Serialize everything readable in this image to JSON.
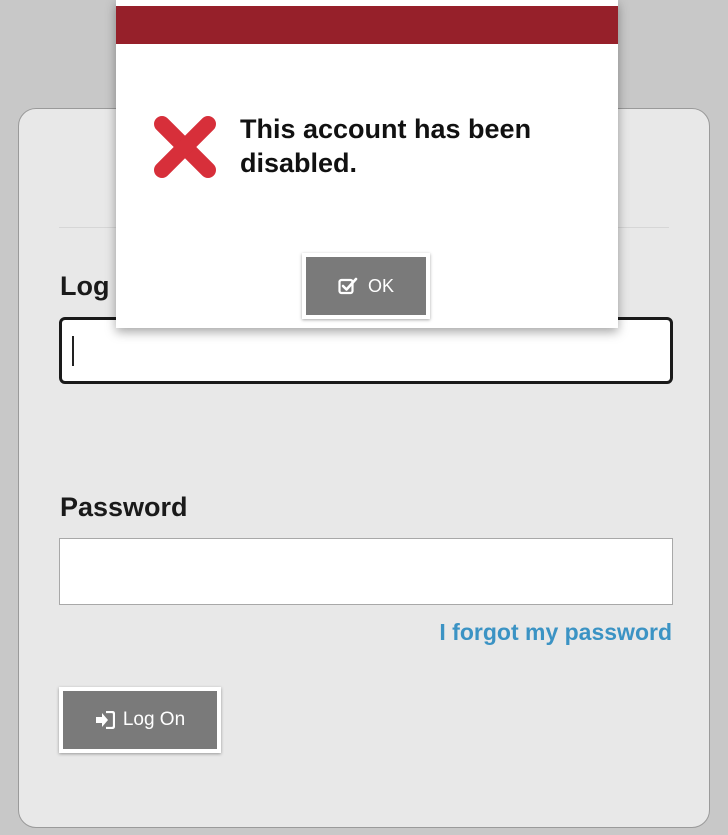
{
  "login_form": {
    "login_label": "Log",
    "login_value": "",
    "password_label": "Password",
    "password_value": "",
    "forgot_password_link": "I forgot my password",
    "logon_button_label": "Log On",
    "logon_icon": "sign-in-icon"
  },
  "dialog": {
    "message": "This account has been disabled.",
    "icon": "error-x-icon",
    "ok_button_label": "OK",
    "ok_icon": "check-square-icon"
  },
  "colors": {
    "page_background": "#c8c8c8",
    "panel_background": "#e8e8e8",
    "dialog_header": "#96202a",
    "error_icon": "#d72f3a",
    "button_background": "#7a7a7a",
    "link": "#3b93c4"
  }
}
